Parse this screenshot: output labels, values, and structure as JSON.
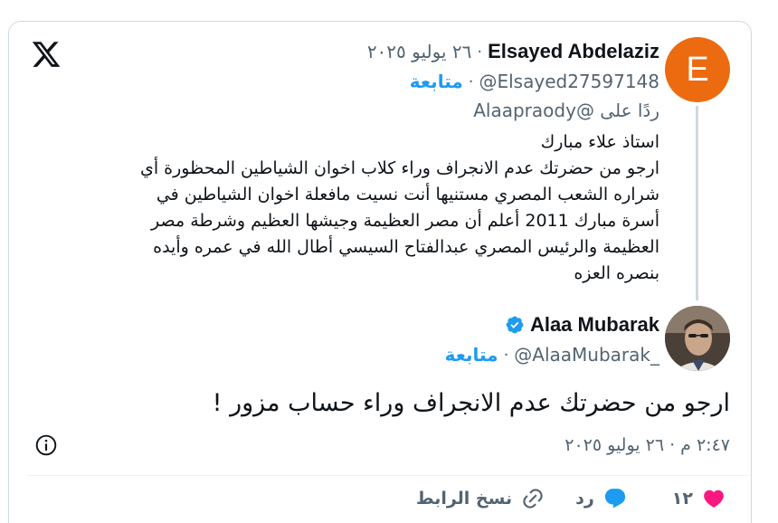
{
  "parent": {
    "avatar_letter": "E",
    "avatar_color": "#ec6b10",
    "name": "Elsayed Abdelaziz",
    "date": "٢٦ يوليو ٢٠٢٥",
    "handle": "@Elsayed27597148",
    "follow_label": "متابعة",
    "reply_prefix": "ردًا على",
    "reply_handle": "@Alaapraody",
    "body_lines": [
      "استاذ علاء مبارك",
      "ارجو من حضرتك عدم الانجراف وراء كلاب اخوان الشياطين المحظورة أي",
      "شراره الشعب المصري مستنيها أنت نسيت مافعلة اخوان الشياطين  في",
      "أسرة مبارك 2011 أعلم أن مصر العظيمة وجيشها العظيم وشرطة مصر",
      "العظيمة والرئيس المصري عبدالفتاح السيسي أطال الله في عمره وأيده",
      "بنصره العزه"
    ]
  },
  "main": {
    "name": "Alaa Mubarak",
    "handle": "@AlaaMubarak_",
    "follow_label": "متابعة",
    "text": "ارجو من حضرتك عدم الانجراف وراء حساب مزور !",
    "timestamp": "٢:٤٧ م · ٢٦ يوليو ٢٠٢٥"
  },
  "actions": {
    "likes_count": "١٢",
    "reply_label": "رد",
    "copy_link_label": "نسخ الرابط"
  },
  "colors": {
    "accent": "#1d9bf0",
    "like": "#f91880",
    "muted": "#536471"
  },
  "icons": [
    "x-logo-icon",
    "verified-badge-icon",
    "info-icon",
    "heart-icon",
    "reply-bubble-icon",
    "link-icon"
  ]
}
